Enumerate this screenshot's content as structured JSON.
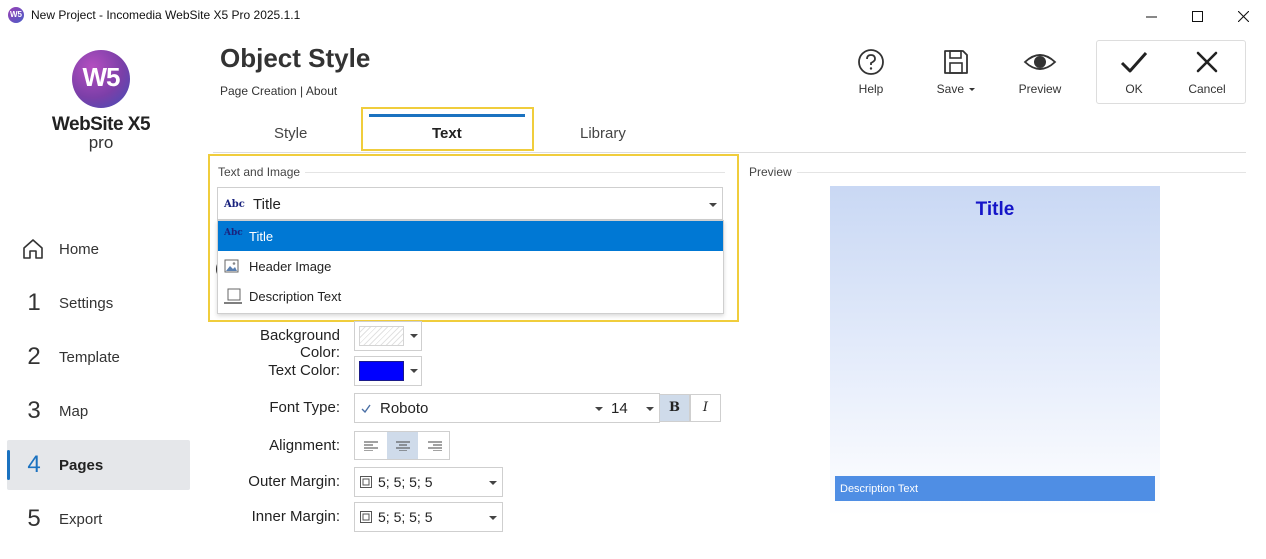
{
  "window": {
    "title": "New Project - Incomedia WebSite X5 Pro 2025.1.1",
    "icon_text": "W5"
  },
  "logo": {
    "mark": "W5",
    "line1": "WebSite X5",
    "line2": "pro"
  },
  "sidebar": {
    "items": [
      {
        "num": "",
        "icon": "home-icon",
        "label": "Home"
      },
      {
        "num": "1",
        "label": "Settings"
      },
      {
        "num": "2",
        "label": "Template"
      },
      {
        "num": "3",
        "label": "Map"
      },
      {
        "num": "4",
        "label": "Pages",
        "active": true
      },
      {
        "num": "5",
        "label": "Export"
      }
    ]
  },
  "header": {
    "title": "Object Style",
    "breadcrumb": "Page Creation | About"
  },
  "toolbar": {
    "help": "Help",
    "save": "Save",
    "preview": "Preview",
    "ok": "OK",
    "cancel": "Cancel"
  },
  "tabs": [
    {
      "label": "Style"
    },
    {
      "label": "Text",
      "active": true
    },
    {
      "label": "Library"
    }
  ],
  "text_and_image": {
    "section_label": "Text and Image",
    "selected": "Title",
    "selected_icon": "Abc",
    "options": [
      {
        "label": "Title",
        "icon": "abc-text-icon",
        "selected": true
      },
      {
        "label": "Header Image",
        "icon": "image-icon"
      },
      {
        "label": "Description Text",
        "icon": "description-text-icon"
      }
    ]
  },
  "form": {
    "background_color_label": "Background Color:",
    "text_color_label": "Text Color:",
    "text_color": "#0000ff",
    "font_type_label": "Font Type:",
    "font_name": "Roboto",
    "font_size": "14",
    "bold": "B",
    "italic": "I",
    "alignment_label": "Alignment:",
    "alignment_selected": "center",
    "outer_margin_label": "Outer Margin:",
    "outer_margin": "5; 5; 5; 5",
    "inner_margin_label": "Inner Margin:",
    "inner_margin": "5; 5; 5; 5"
  },
  "preview": {
    "section_label": "Preview",
    "title": "Title",
    "description": "Description Text"
  },
  "colors": {
    "accent": "#1b72c0",
    "selection": "#0078d4",
    "highlight": "#f0cd3c",
    "preview_title": "#1515c8",
    "preview_desc_bg": "#4f8ee4"
  }
}
